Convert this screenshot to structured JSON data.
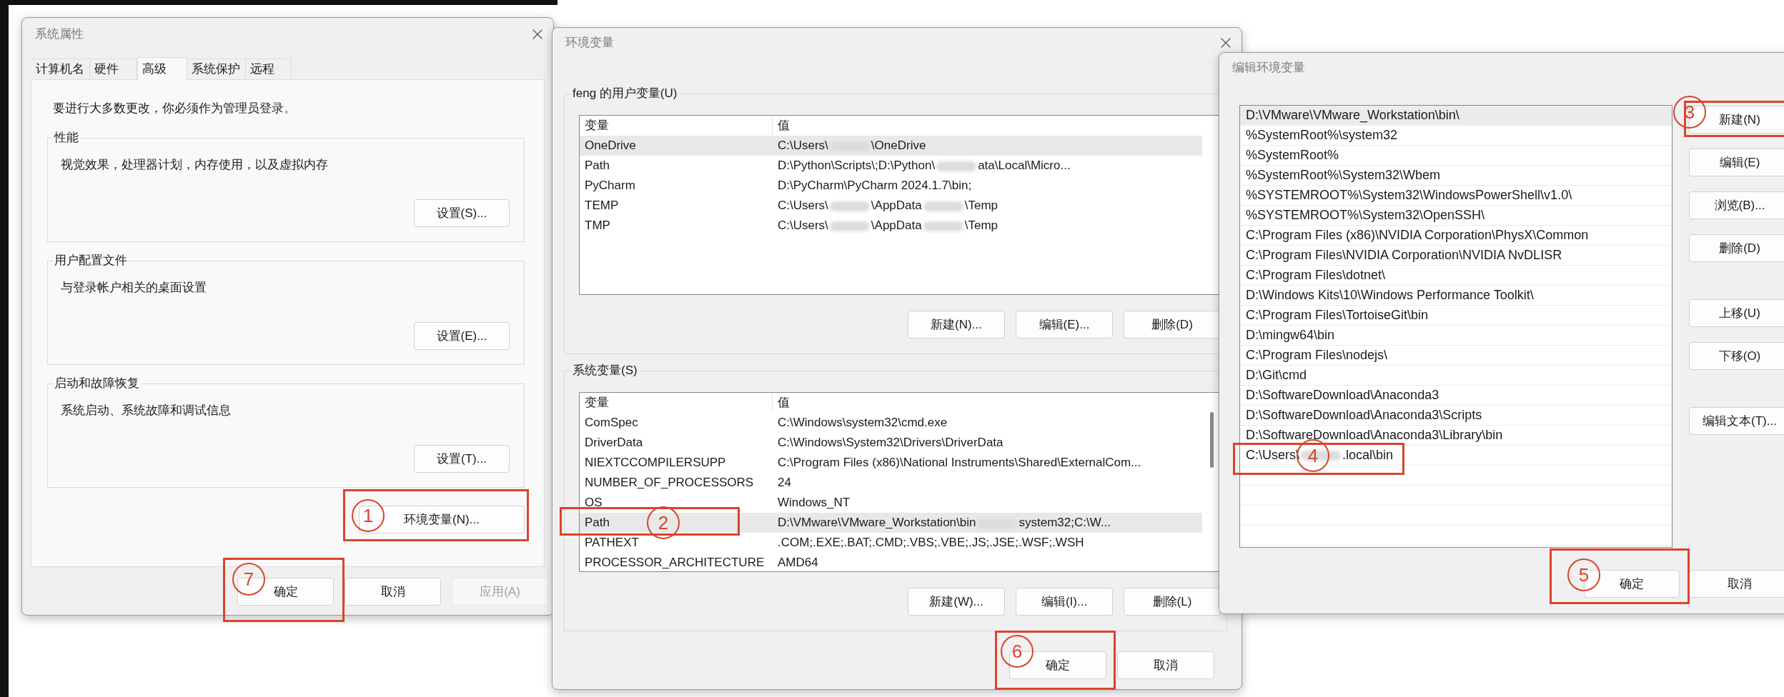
{
  "system_properties": {
    "title": "系统属性",
    "tabs": [
      {
        "label": "计算机名",
        "selected": false
      },
      {
        "label": "硬件",
        "selected": false
      },
      {
        "label": "高级",
        "selected": true
      },
      {
        "label": "系统保护",
        "selected": false
      },
      {
        "label": "远程",
        "selected": false
      }
    ],
    "admin_notice": "要进行大多数更改，你必须作为管理员登录。",
    "groups": [
      {
        "label": "性能",
        "description": "视觉效果，处理器计划，内存使用，以及虚拟内存",
        "button": "设置(S)..."
      },
      {
        "label": "用户配置文件",
        "description": "与登录帐户相关的桌面设置",
        "button": "设置(E)..."
      },
      {
        "label": "启动和故障恢复",
        "description": "系统启动、系统故障和调试信息",
        "button": "设置(T)..."
      }
    ],
    "env_button": "环境变量(N)...",
    "footer_buttons": [
      {
        "label": "确定",
        "disabled": false
      },
      {
        "label": "取消",
        "disabled": false
      },
      {
        "label": "应用(A)",
        "disabled": true
      }
    ]
  },
  "environment_variables": {
    "title": "环境变量",
    "sections": [
      {
        "label": "feng 的用户变量(U)",
        "columns": [
          "变量",
          "值"
        ],
        "scrollable": false,
        "rows": [
          {
            "name": "OneDrive",
            "value": [
              "C:\\Users\\",
              "\\OneDrive"
            ],
            "selected": true
          },
          {
            "name": "Path",
            "value": [
              "D:\\Python\\Scripts\\;D:\\Python\\",
              "ata\\Local\\Micro..."
            ],
            "selected": false
          },
          {
            "name": "PyCharm",
            "value": [
              "D:\\PyCharm\\PyCharm 2024.1.7\\bin;"
            ],
            "selected": false
          },
          {
            "name": "TEMP",
            "value": [
              "C:\\Users\\",
              "\\AppData",
              "\\Temp"
            ],
            "selected": false
          },
          {
            "name": "TMP",
            "value": [
              "C:\\Users\\",
              "\\AppData",
              "\\Temp"
            ],
            "selected": false
          }
        ],
        "buttons": [
          "新建(N)...",
          "编辑(E)...",
          "删除(D)"
        ]
      },
      {
        "label": "系统变量(S)",
        "columns": [
          "变量",
          "值"
        ],
        "scrollable": true,
        "rows": [
          {
            "name": "ComSpec",
            "value": [
              "C:\\Windows\\system32\\cmd.exe"
            ],
            "selected": false
          },
          {
            "name": "DriverData",
            "value": [
              "C:\\Windows\\System32\\Drivers\\DriverData"
            ],
            "selected": false
          },
          {
            "name": "NIEXTCCOMPILERSUPP",
            "value": [
              "C:\\Program Files (x86)\\National Instruments\\Shared\\ExternalCom..."
            ],
            "selected": false
          },
          {
            "name": "NUMBER_OF_PROCESSORS",
            "value": [
              "24"
            ],
            "selected": false
          },
          {
            "name": "OS",
            "value": [
              "Windows_NT"
            ],
            "selected": false
          },
          {
            "name": "Path",
            "value": [
              "D:\\VMware\\VMware_Workstation\\bin",
              "system32;C:\\W..."
            ],
            "selected": true
          },
          {
            "name": "PATHEXT",
            "value": [
              ".COM;.EXE;.BAT;.CMD;.VBS;.VBE;.JS;.JSE;.WSF;.WSH"
            ],
            "selected": false
          },
          {
            "name": "PROCESSOR_ARCHITECTURE",
            "value": [
              "AMD64"
            ],
            "selected": false
          }
        ],
        "buttons": [
          "新建(W)...",
          "编辑(I)...",
          "删除(L)"
        ]
      }
    ],
    "footer_buttons": [
      "确定",
      "取消"
    ]
  },
  "edit_environment_variable": {
    "title": "编辑环境变量",
    "entries": [
      {
        "value": [
          "D:\\VMware\\VMware_Workstation\\bin\\"
        ],
        "selected": true
      },
      {
        "value": [
          "%SystemRoot%\\system32"
        ],
        "selected": false
      },
      {
        "value": [
          "%SystemRoot%"
        ],
        "selected": false
      },
      {
        "value": [
          "%SystemRoot%\\System32\\Wbem"
        ],
        "selected": false
      },
      {
        "value": [
          "%SYSTEMROOT%\\System32\\WindowsPowerShell\\v1.0\\"
        ],
        "selected": false
      },
      {
        "value": [
          "%SYSTEMROOT%\\System32\\OpenSSH\\"
        ],
        "selected": false
      },
      {
        "value": [
          "C:\\Program Files (x86)\\NVIDIA Corporation\\PhysX\\Common"
        ],
        "selected": false
      },
      {
        "value": [
          "C:\\Program Files\\NVIDIA Corporation\\NVIDIA NvDLISR"
        ],
        "selected": false
      },
      {
        "value": [
          "C:\\Program Files\\dotnet\\"
        ],
        "selected": false
      },
      {
        "value": [
          "D:\\Windows Kits\\10\\Windows Performance Toolkit\\"
        ],
        "selected": false
      },
      {
        "value": [
          "C:\\Program Files\\TortoiseGit\\bin"
        ],
        "selected": false
      },
      {
        "value": [
          "D:\\mingw64\\bin"
        ],
        "selected": false
      },
      {
        "value": [
          "C:\\Program Files\\nodejs\\"
        ],
        "selected": false
      },
      {
        "value": [
          "D:\\Git\\cmd"
        ],
        "selected": false
      },
      {
        "value": [
          "D:\\SoftwareDownload\\Anaconda3"
        ],
        "selected": false
      },
      {
        "value": [
          "D:\\SoftwareDownload\\Anaconda3\\Scripts"
        ],
        "selected": false
      },
      {
        "value": [
          "D:\\SoftwareDownload\\Anaconda3\\Library\\bin"
        ],
        "selected": false
      },
      {
        "value": [
          "C:\\Users\\",
          ".local\\bin"
        ],
        "selected": false
      }
    ],
    "side_buttons": [
      [
        "新建(N)",
        "编辑(E)",
        "浏览(B)...",
        "删除(D)"
      ],
      [
        "上移(U)",
        "下移(O)"
      ],
      [
        "编辑文本(T)..."
      ]
    ],
    "footer_buttons": [
      "确定",
      "取消"
    ]
  },
  "annotations": [
    {
      "number": "1"
    },
    {
      "number": "2"
    },
    {
      "number": "3"
    },
    {
      "number": "4"
    },
    {
      "number": "5"
    },
    {
      "number": "6"
    },
    {
      "number": "7"
    }
  ]
}
